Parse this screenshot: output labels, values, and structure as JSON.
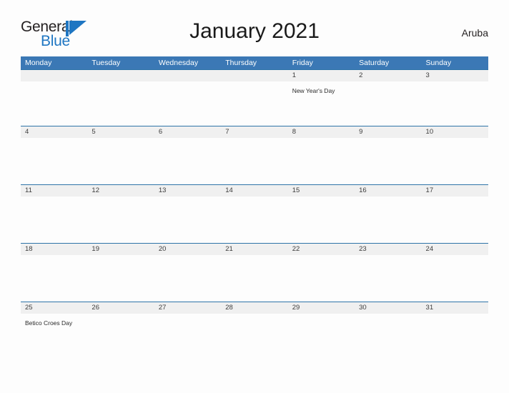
{
  "brand": {
    "name_part1": "General",
    "name_part2": "Blue",
    "mark": "triangle-logo-icon",
    "accent_color": "#1f76c2"
  },
  "header": {
    "title": "January 2021",
    "country": "Aruba"
  },
  "theme": {
    "header_blue": "#3b78b5",
    "row_line_blue": "#2e74a8",
    "date_band_gray": "#f0f0f0",
    "page_background": "#fdfdfd"
  },
  "calendar": {
    "weekday_headers": [
      "Monday",
      "Tuesday",
      "Wednesday",
      "Thursday",
      "Friday",
      "Saturday",
      "Sunday"
    ],
    "weeks": [
      {
        "days": [
          {
            "number": "",
            "event": ""
          },
          {
            "number": "",
            "event": ""
          },
          {
            "number": "",
            "event": ""
          },
          {
            "number": "",
            "event": ""
          },
          {
            "number": "1",
            "event": "New Year's Day"
          },
          {
            "number": "2",
            "event": ""
          },
          {
            "number": "3",
            "event": ""
          }
        ]
      },
      {
        "days": [
          {
            "number": "4",
            "event": ""
          },
          {
            "number": "5",
            "event": ""
          },
          {
            "number": "6",
            "event": ""
          },
          {
            "number": "7",
            "event": ""
          },
          {
            "number": "8",
            "event": ""
          },
          {
            "number": "9",
            "event": ""
          },
          {
            "number": "10",
            "event": ""
          }
        ]
      },
      {
        "days": [
          {
            "number": "11",
            "event": ""
          },
          {
            "number": "12",
            "event": ""
          },
          {
            "number": "13",
            "event": ""
          },
          {
            "number": "14",
            "event": ""
          },
          {
            "number": "15",
            "event": ""
          },
          {
            "number": "16",
            "event": ""
          },
          {
            "number": "17",
            "event": ""
          }
        ]
      },
      {
        "days": [
          {
            "number": "18",
            "event": ""
          },
          {
            "number": "19",
            "event": ""
          },
          {
            "number": "20",
            "event": ""
          },
          {
            "number": "21",
            "event": ""
          },
          {
            "number": "22",
            "event": ""
          },
          {
            "number": "23",
            "event": ""
          },
          {
            "number": "24",
            "event": ""
          }
        ]
      },
      {
        "days": [
          {
            "number": "25",
            "event": "Betico Croes Day"
          },
          {
            "number": "26",
            "event": ""
          },
          {
            "number": "27",
            "event": ""
          },
          {
            "number": "28",
            "event": ""
          },
          {
            "number": "29",
            "event": ""
          },
          {
            "number": "30",
            "event": ""
          },
          {
            "number": "31",
            "event": ""
          }
        ]
      }
    ]
  }
}
